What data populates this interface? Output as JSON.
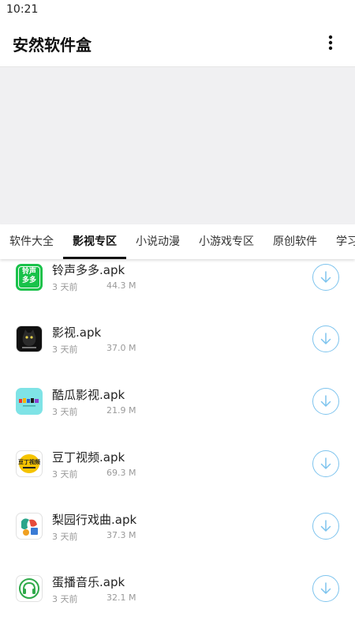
{
  "status_bar": {
    "time": "10:21"
  },
  "app_bar": {
    "title": "安然软件盒",
    "menu_icon": "more-vertical-icon"
  },
  "tabs": [
    {
      "label": "软件大全",
      "active": false
    },
    {
      "label": "影视专区",
      "active": true
    },
    {
      "label": "小说动漫",
      "active": false
    },
    {
      "label": "小游戏专区",
      "active": false
    },
    {
      "label": "原创软件",
      "active": false
    },
    {
      "label": "学习",
      "active": false
    }
  ],
  "files": [
    {
      "name": "铃声多多.apk",
      "time": "3 天前",
      "size": "44.3 M",
      "icon": "lingsheng-duoduo-app-icon",
      "icon_text": "铃声多多"
    },
    {
      "name": "影视.apk",
      "time": "3 天前",
      "size": "37.0 M",
      "icon": "black-cat-app-icon"
    },
    {
      "name": "酷瓜影视.apk",
      "time": "3 天前",
      "size": "21.9 M",
      "icon": "kugua-app-icon"
    },
    {
      "name": "豆丁视频.apk",
      "time": "3 天前",
      "size": "69.3 M",
      "icon": "douding-app-icon",
      "icon_text": "豆丁视频"
    },
    {
      "name": "梨园行戏曲.apk",
      "time": "3 天前",
      "size": "37.3 M",
      "icon": "liyuan-app-icon"
    },
    {
      "name": "蛋播音乐.apk",
      "time": "3 天前",
      "size": "32.1 M",
      "icon": "danbo-music-app-icon"
    }
  ],
  "colors": {
    "accent": "#7ec4ee",
    "green": "#19c24a",
    "banner": "#f0f0f2"
  }
}
